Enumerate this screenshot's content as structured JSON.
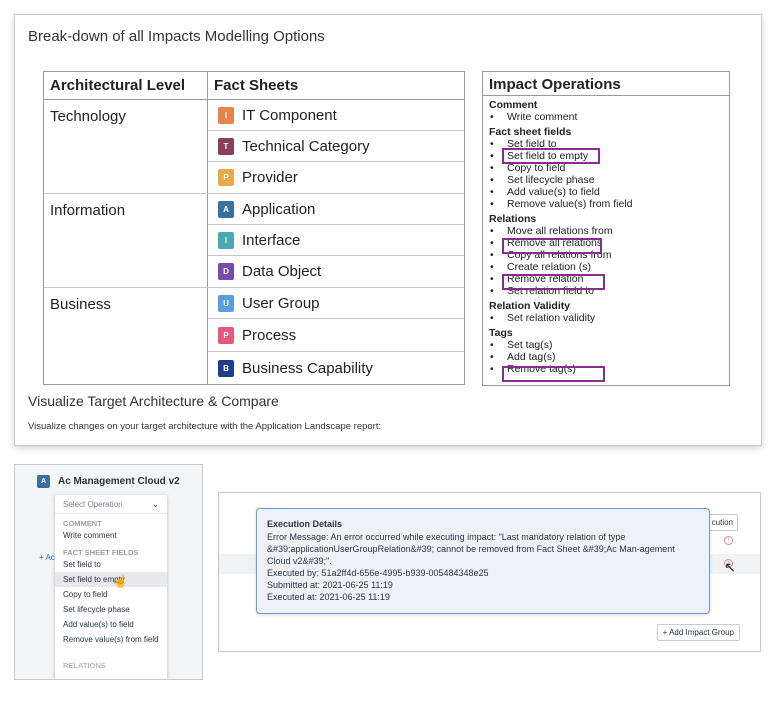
{
  "top": {
    "title": "Break-down of all Impacts Modelling Options",
    "table": {
      "col_level": "Architectural Level",
      "col_sheets": "Fact Sheets",
      "groups": [
        {
          "level": "Technology",
          "sheets": [
            {
              "letter": "I",
              "color": "#e8844a",
              "name": "IT Component"
            },
            {
              "letter": "T",
              "color": "#8a3d5c",
              "name": "Technical Category"
            },
            {
              "letter": "P",
              "color": "#e9a94a",
              "name": "Provider"
            }
          ]
        },
        {
          "level": "Information",
          "sheets": [
            {
              "letter": "A",
              "color": "#3a6f9e",
              "name": "Application"
            },
            {
              "letter": "I",
              "color": "#4aaab4",
              "name": "Interface"
            },
            {
              "letter": "D",
              "color": "#7a4aa8",
              "name": "Data Object"
            }
          ]
        },
        {
          "level": "Business",
          "sheets": [
            {
              "letter": "U",
              "color": "#5a9ee0",
              "name": "User Group"
            },
            {
              "letter": "P",
              "color": "#e45a7a",
              "name": "Process"
            },
            {
              "letter": "B",
              "color": "#1f3d8a",
              "name": "Business Capability"
            }
          ]
        }
      ]
    },
    "ops": {
      "title": "Impact Operations",
      "categories": [
        {
          "name": "Comment",
          "items": [
            "Write comment"
          ]
        },
        {
          "name": "Fact sheet fields",
          "items": [
            "Set field to",
            "Set field to empty",
            "Copy to field",
            "Set lifecycle phase",
            "Add value(s) to field",
            "Remove value(s) from field"
          ]
        },
        {
          "name": "Relations",
          "items": [
            "Move all relations from",
            "Remove all relations",
            "Copy all relations from",
            "Create relation (s)",
            "Remove relation",
            "Set relation field to"
          ]
        },
        {
          "name": "Relation Validity",
          "items": [
            "Set relation validity"
          ]
        },
        {
          "name": "Tags",
          "items": [
            "Set tag(s)",
            "Add tag(s)",
            "Remove tag(s)"
          ]
        }
      ],
      "highlight_color": "#8a2c8e"
    },
    "visualize_title": "Visualize Target Architecture & Compare",
    "visualize_caption": "Visualize changes on your target architecture with the Application Landscape report:"
  },
  "left": {
    "fact_sheet": {
      "letter": "A",
      "color": "#3a6f9e",
      "name": "Ac Management Cloud v2"
    },
    "add_link": "+ Ac",
    "dropdown": {
      "placeholder": "Select Operation",
      "group_comment": "COMMENT",
      "write_comment": "Write comment",
      "group_fields": "FACT SHEET FIELDS",
      "items": [
        "Set field to",
        "Set field to empty",
        "Copy to field",
        "Set lifecycle phase",
        "Add value(s) to field",
        "Remove value(s) from field"
      ],
      "more": "RELATIONS"
    }
  },
  "right": {
    "execution_button": "cution",
    "tooltip": {
      "title": "Execution Details",
      "message": "Error Message: An error occurred while executing impact: \"Last mandatory relation of type &#39;applicationUserGroupRelation&#39; cannot be removed from Fact Sheet &#39;Ac Man-agement Cloud v2&#39;\".",
      "executed_by": "Executed by: 51a2ff4d-656e-4995-b939-005484348e25",
      "submitted_at": "Submitted at: 2021-06-25 11:19",
      "executed_at": "Executed at: 2021-06-25 11:19"
    },
    "add_group_button": "+ Add Impact Group",
    "error_icon": "!"
  }
}
